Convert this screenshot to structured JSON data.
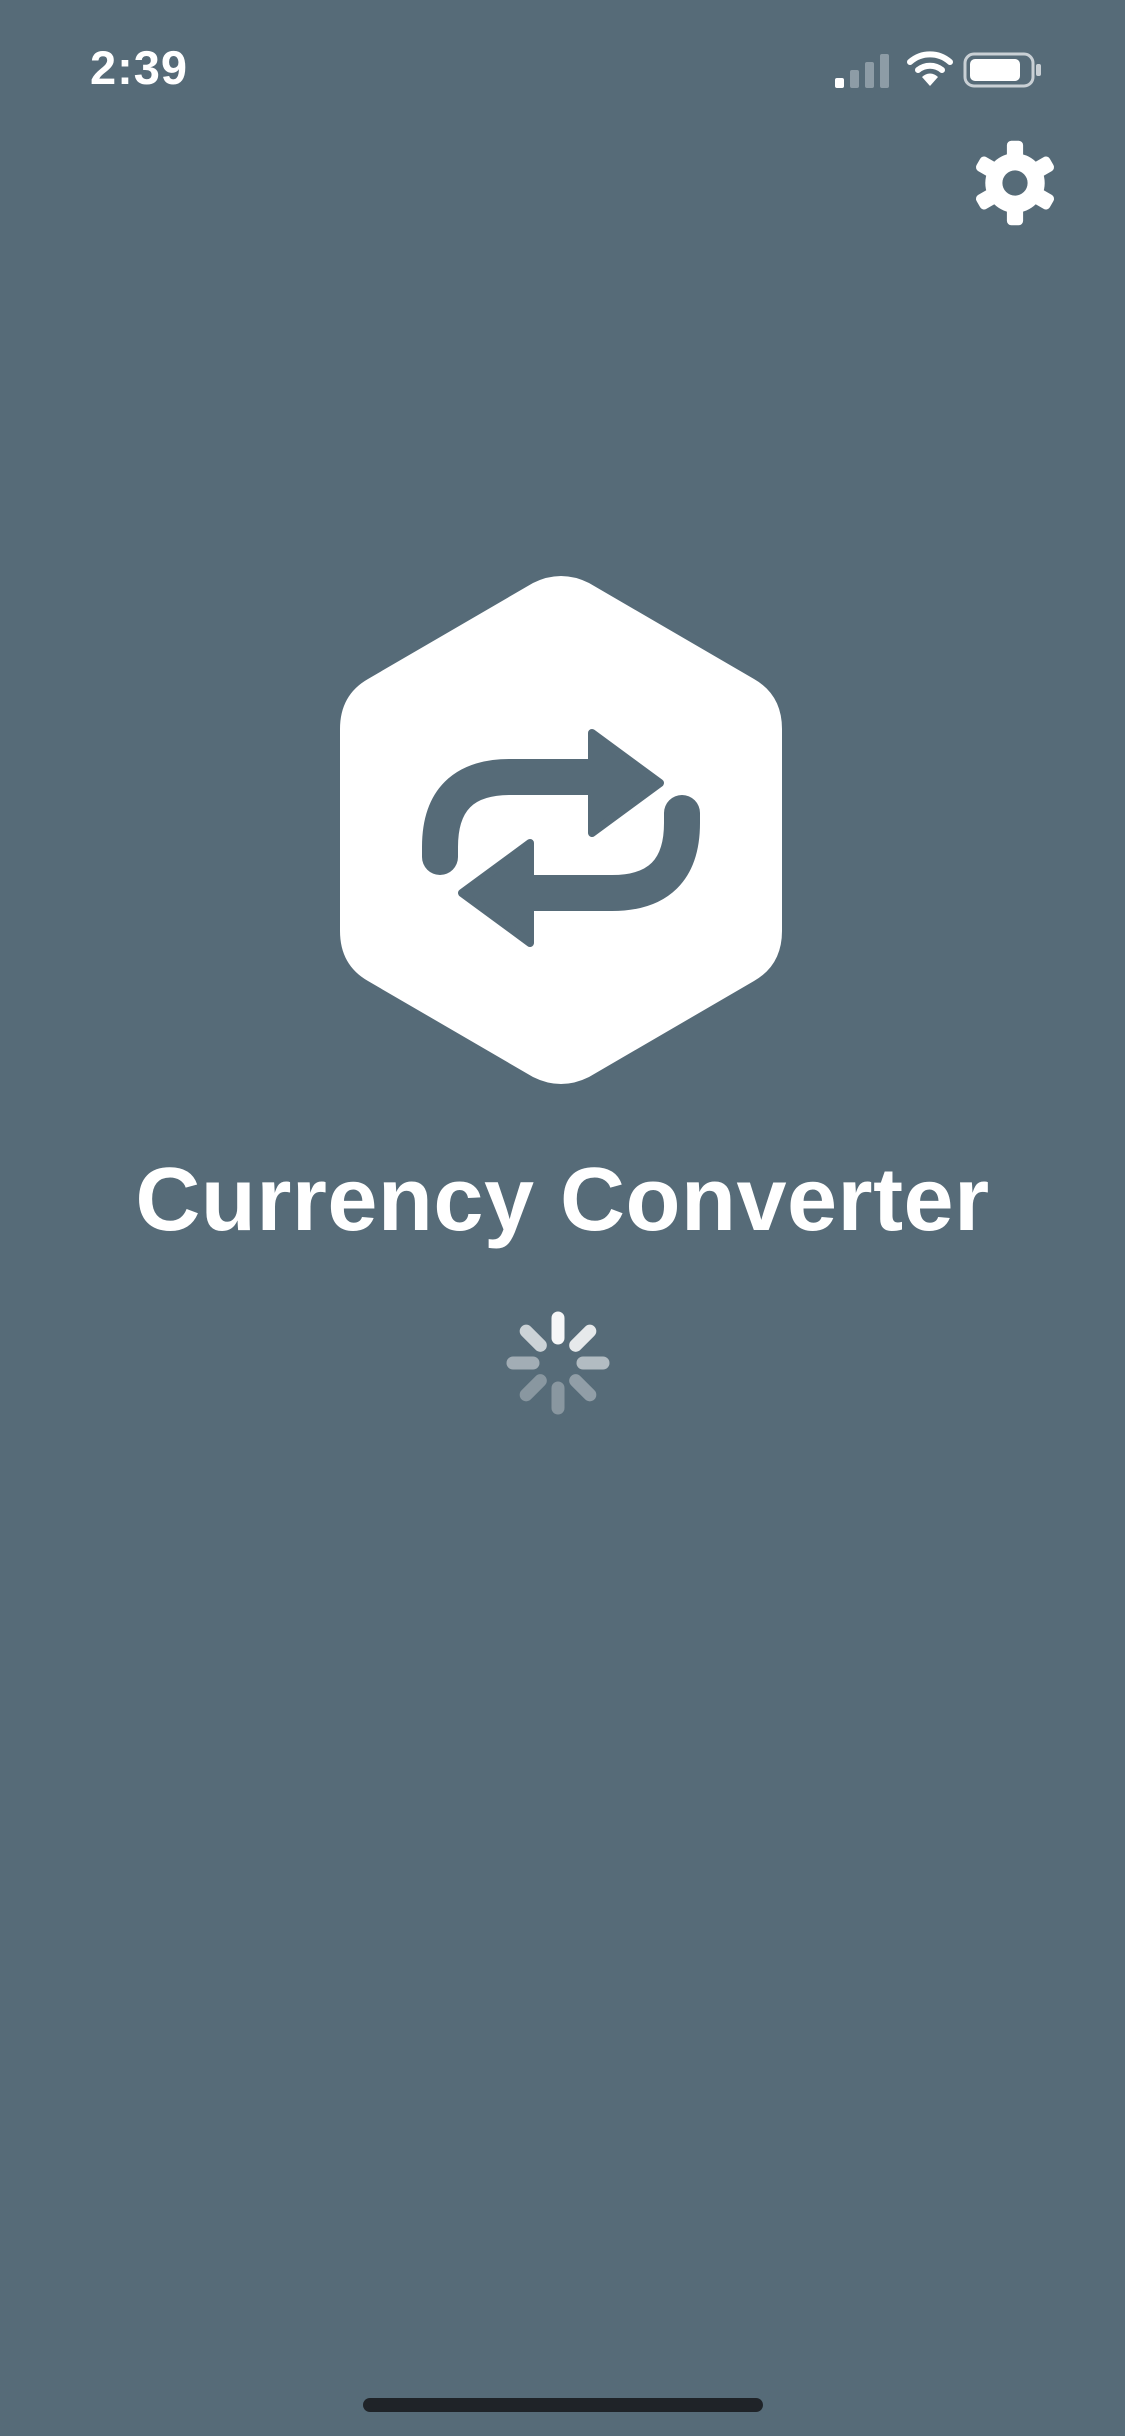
{
  "status_bar": {
    "time": "2:39",
    "signal_icon": "cellular-signal-icon",
    "wifi_icon": "wifi-icon",
    "battery_icon": "battery-icon"
  },
  "toolbar": {
    "settings_icon": "gear-icon"
  },
  "splash": {
    "logo_icon": "currency-exchange-arrows-icon",
    "title": "Currency Converter",
    "loading_indicator": "activity-spinner-icon"
  },
  "colors": {
    "background": "#566b78",
    "foreground": "#ffffff",
    "home_indicator": "#1f2328"
  }
}
